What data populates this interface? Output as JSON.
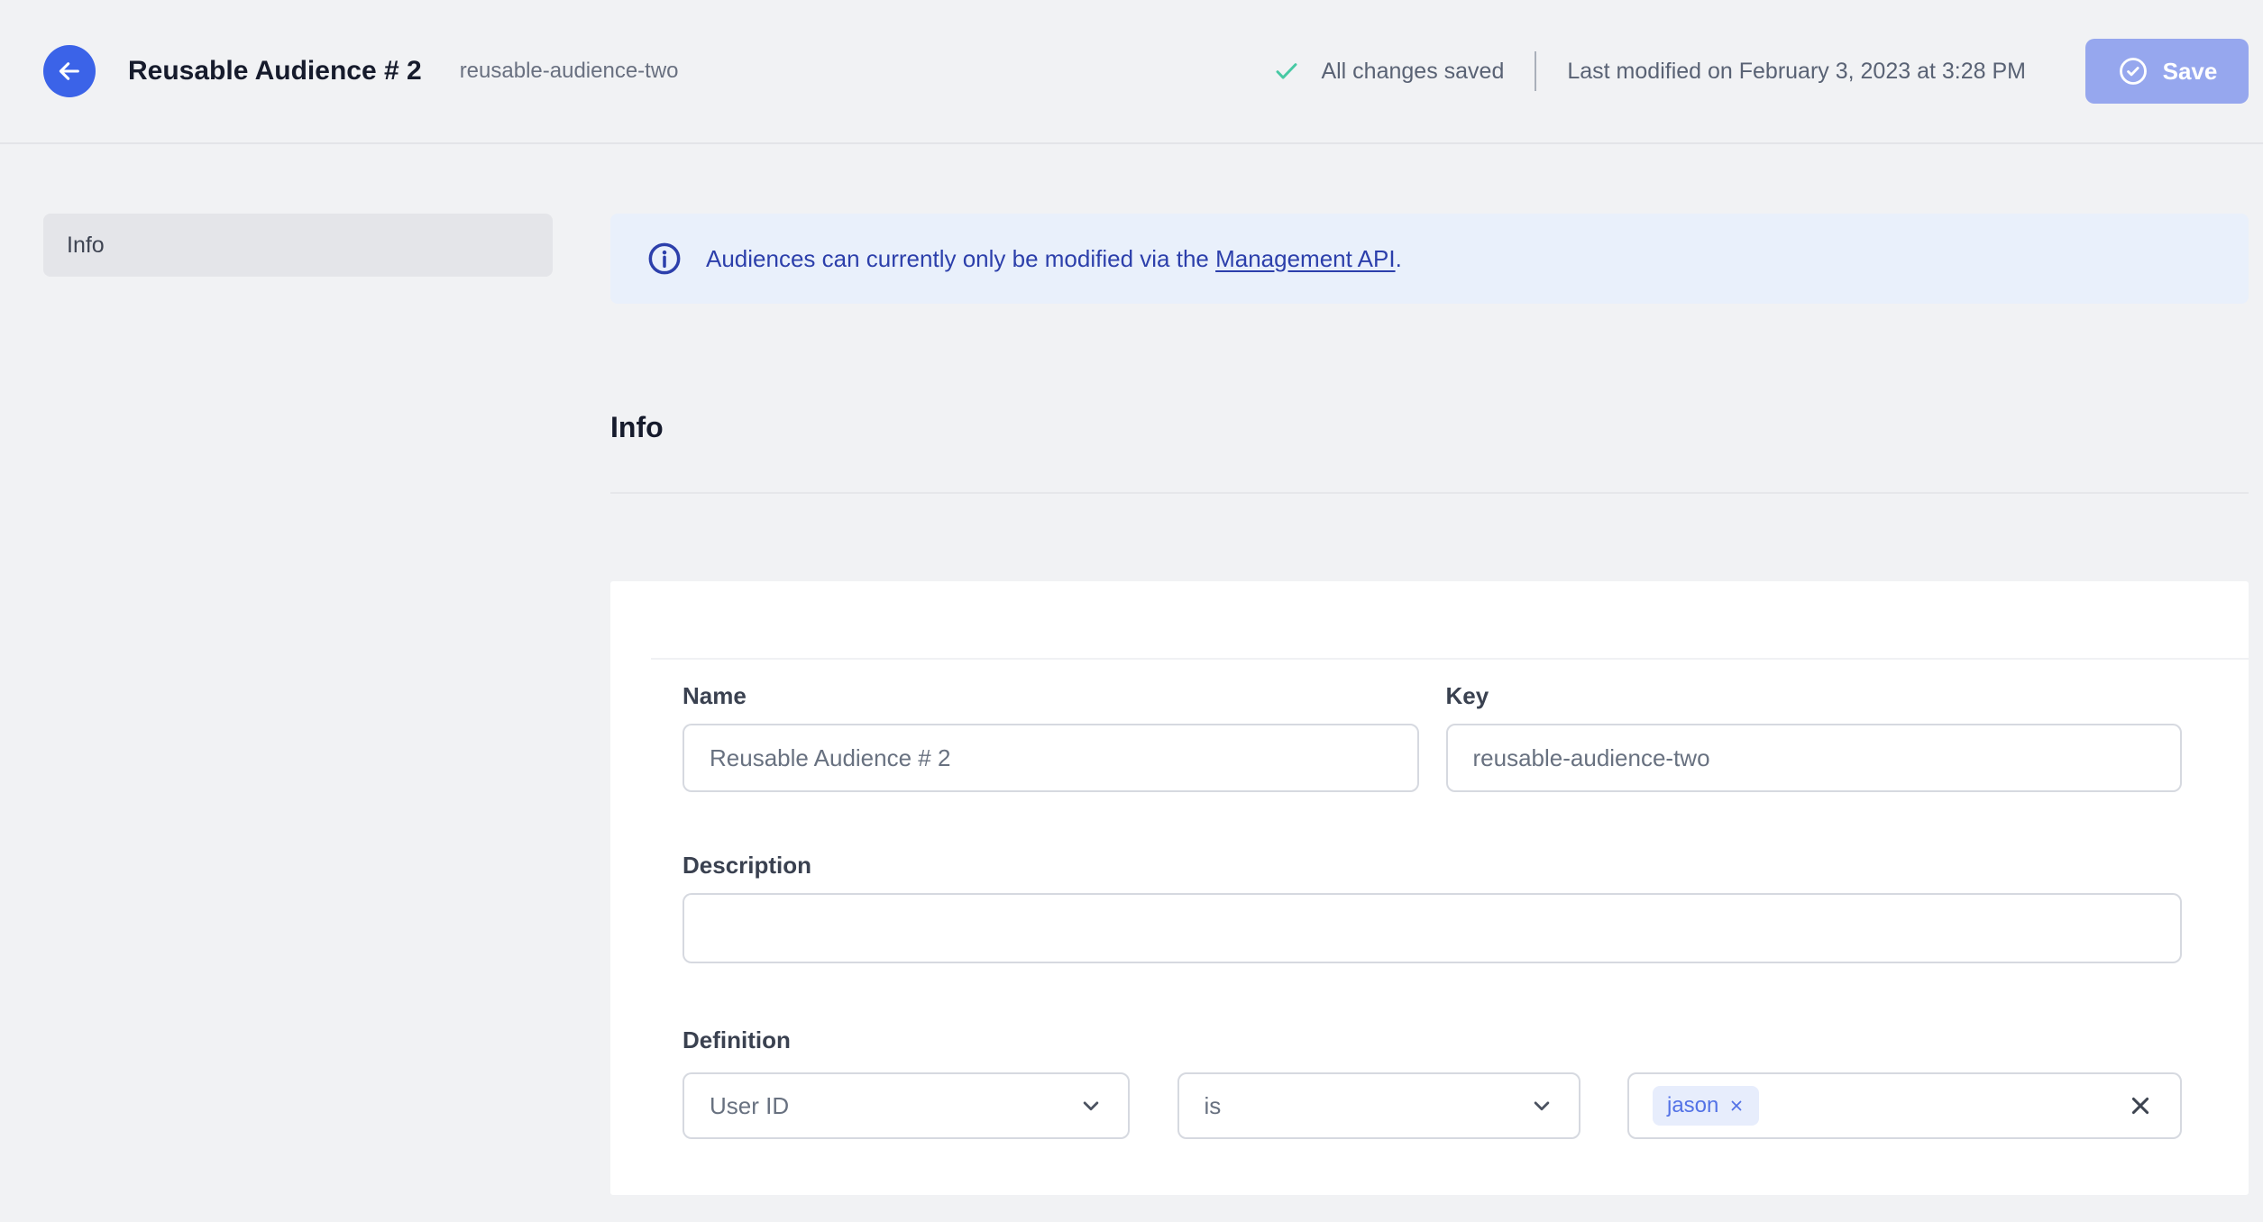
{
  "header": {
    "title": "Reusable Audience # 2",
    "subtitle": "reusable-audience-two",
    "status": "All changes saved",
    "last_modified": "Last modified on February 3, 2023 at 3:28 PM",
    "save_label": "Save"
  },
  "sidebar": {
    "items": [
      {
        "label": "Info",
        "active": true
      }
    ]
  },
  "banner": {
    "text_before_link": "Audiences can currently only be modified via the ",
    "link_text": "Management API",
    "text_after_link": "."
  },
  "section": {
    "title": "Info"
  },
  "form": {
    "name": {
      "label": "Name",
      "value": "Reusable Audience # 2"
    },
    "key": {
      "label": "Key",
      "value": "reusable-audience-two"
    },
    "description": {
      "label": "Description",
      "value": ""
    },
    "definition": {
      "label": "Definition",
      "trait_selector": {
        "value": "User ID"
      },
      "operator_selector": {
        "value": "is"
      },
      "values": {
        "tags": [
          "jason"
        ]
      }
    }
  },
  "icons": {
    "back": "arrow-left",
    "status": "check",
    "save": "circle-check",
    "banner": "info-circle",
    "selects": "chevron-down",
    "tag_remove": "x",
    "clear": "x"
  },
  "colors": {
    "accent_blue": "#3b63e8",
    "save_button": "#96a7ee",
    "status_check": "#47c9a4",
    "banner_bg": "#e9f0fb",
    "banner_text": "#2c3fab",
    "tag_bg": "#e7edfc",
    "tag_text": "#5372e6",
    "page_bg": "#f1f2f4",
    "card_bg": "#ffffff",
    "input_border": "#d6d9e0"
  }
}
